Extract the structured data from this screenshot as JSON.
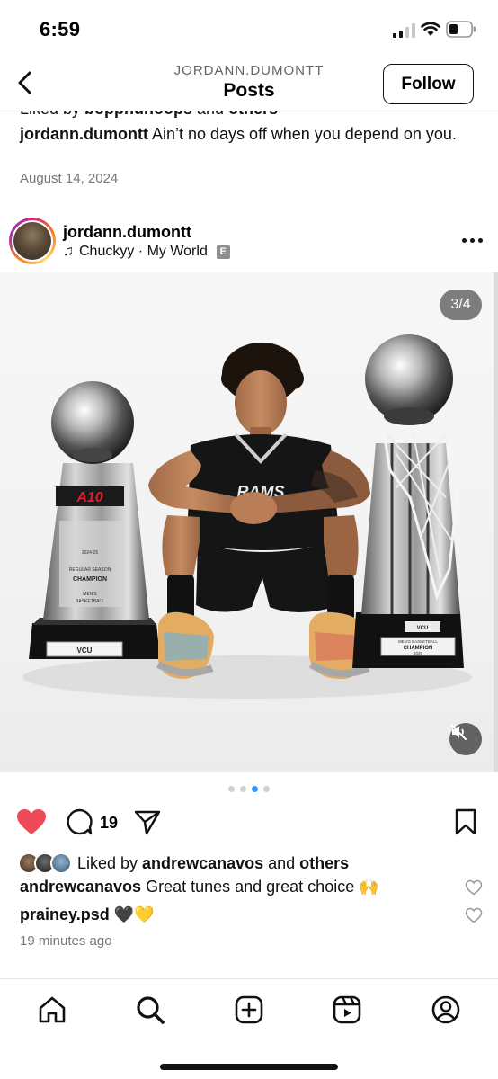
{
  "status_bar": {
    "time": "6:59"
  },
  "header": {
    "username": "JORDANN.DUMONTT",
    "title": "Posts",
    "follow_label": "Follow"
  },
  "previous_post": {
    "liked_prefix": "Liked by ",
    "liked_user": "boppnunoops",
    "liked_mid": " and ",
    "liked_others": "others",
    "caption_user": "jordann.dumontt",
    "caption_text": " Ain’t no days off when you depend on you.",
    "date": "August 14, 2024"
  },
  "post": {
    "username": "jordann.dumontt",
    "music": "Chuckyy · My World",
    "explicit_badge": "E",
    "image_counter": "3/4",
    "carousel": {
      "count": 4,
      "active_index": 2
    },
    "comment_count": "19",
    "liked_prefix": "Liked by ",
    "liked_user": "andrewcanavos",
    "liked_mid": " and ",
    "liked_others": "others",
    "comments": [
      {
        "user": "andrewcanavos",
        "text": " Great tunes and great choice 🙌"
      },
      {
        "user": "prainey.psd",
        "text": " 🖤💛"
      }
    ],
    "time_ago": "19 minutes ago",
    "photo_text": {
      "a10_logo": "A10",
      "left_plaque_year": "2024-25",
      "left_plaque_line1": "REGULAR SEASON",
      "left_plaque_line2": "CHAMPION",
      "left_plaque_line3": "MEN'S",
      "left_plaque_line4": "BASKETBALL",
      "left_base_label": "VCU",
      "jersey_text": "RAMS",
      "right_top_label": "VCU",
      "right_plaque_line1": "MEN'S BASKETBALL",
      "right_plaque_line2": "CHAMPION",
      "right_plaque_line3": "2025"
    }
  },
  "colors": {
    "like_red": "#ed4956",
    "active_dot": "#3897f0",
    "muted_text": "#777777"
  },
  "icons": {
    "nav": [
      "home-icon",
      "search-icon",
      "create-icon",
      "reels-icon",
      "profile-icon"
    ]
  }
}
